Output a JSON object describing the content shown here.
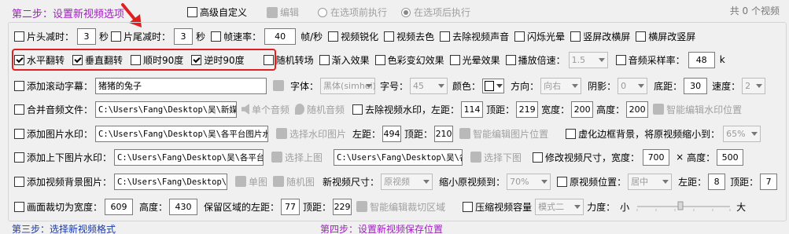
{
  "header": {
    "step2": "第二步：设置新视频选项",
    "advanced": "高级自定义",
    "edit": "编辑",
    "before": "在选项前执行",
    "after": "在选项后执行",
    "video_count": "共 0 个视频"
  },
  "r1": {
    "head": "片头减时：",
    "head_val": "3",
    "sec": "秒",
    "tail": "片尾减时：",
    "tail_val": "3",
    "sec2": "秒",
    "fps": "帧速率：",
    "fps_val": "40",
    "fps_unit": "帧/秒",
    "sharpen": "视频锐化",
    "decolor": "视频去色",
    "remove_audio": "去除视频声音",
    "flash": "闪烁光晕",
    "v2h": "竖屏改横屏",
    "h2v": "横屏改竖屏"
  },
  "r2": {
    "hflip": "水平翻转",
    "vflip": "垂直翻转",
    "cw90": "顺时90度",
    "ccw90": "逆时90度",
    "random_transition": "随机转场",
    "fade_in": "渐入效果",
    "color_change": "色彩变幻效果",
    "halo": "光晕效果",
    "speed": "播放倍速：",
    "speed_val": "1.5",
    "sample_rate": "音频采样率：",
    "sample_val": "48",
    "k": "k"
  },
  "r3": {
    "subtitle": "添加滚动字幕：",
    "subtitle_val": "猪猪的兔子",
    "font": "字体：",
    "font_val": "黑体(simhei)",
    "size": "字号：",
    "size_val": "45",
    "color": "颜色：",
    "direction": "方向：",
    "direction_val": "向右",
    "shadow": "阴影：",
    "shadow_val": "0",
    "bottom": "底距：",
    "bottom_val": "30",
    "speed": "速度：",
    "speed_val": "2"
  },
  "r4": {
    "merge": "合并音频文件：",
    "path": "C:\\Users\\Fang\\Desktop\\吴\\新媒",
    "single": "单个音频",
    "random": "随机音频",
    "remove_wm": "去除视频水印，左距：",
    "left_val": "114",
    "top": "顶距：",
    "top_val": "219",
    "width": "宽度：",
    "width_val": "200",
    "height": "高度：",
    "height_val": "200",
    "smart": "智能编辑水印位置"
  },
  "r5": {
    "img_wm": "添加图片水印：",
    "path": "C:\\Users\\Fang\\Desktop\\吴\\各平台图片水",
    "select": "选择水印图片",
    "left": "左距：",
    "left_val": "494",
    "top": "顶距：",
    "top_val": "210",
    "smart": "智能编辑图片位置",
    "blur": "虚化边框背景，将原视频缩小到：",
    "blur_val": "65%"
  },
  "r6": {
    "updown": "添加上下图片水印：",
    "path_up": "C:\\Users\\Fang\\Desktop\\吴\\各平台",
    "select_up": "选择上图",
    "path_down": "C:\\Users\\Fang\\Desktop\\吴\\各",
    "select_down": "选择下图",
    "resize": "修改视频尺寸，宽度：",
    "width_val": "700",
    "x": "×",
    "height": "高度：",
    "height_val": "500"
  },
  "r7": {
    "bg_img": "添加视频背景图片：",
    "path": "C:\\Users\\Fang\\Desktop\\吴",
    "single": "单图",
    "random": "随机图",
    "new_size": "新视频尺寸：",
    "new_size_val": "原视频",
    "shrink": "缩小原视频到：",
    "shrink_val": "70%",
    "position": "原视频位置：",
    "position_val": "居中",
    "left": "左距：",
    "left_val": "8",
    "top": "顶距：",
    "top_val": "7"
  },
  "r8": {
    "crop": "画面裁切为宽度：",
    "width_val": "609",
    "height": "高度：",
    "height_val": "430",
    "keep": "保留区域的左距：",
    "left_val": "77",
    "top": "顶距：",
    "top_val": "229",
    "smart": "智能编辑裁切区域",
    "compress": "压缩视频容量",
    "mode_val": "模式二",
    "strength": "力度：",
    "small": "小",
    "big": "大",
    "strength_level": "low"
  },
  "footer": {
    "step3": "第三步：选择新视频格式",
    "step4": "第四步：设置新视频保存位置"
  },
  "colors": {
    "step_color": "#a020c0",
    "step3_color": "#1a3aa8",
    "arrow": "#e02020"
  }
}
